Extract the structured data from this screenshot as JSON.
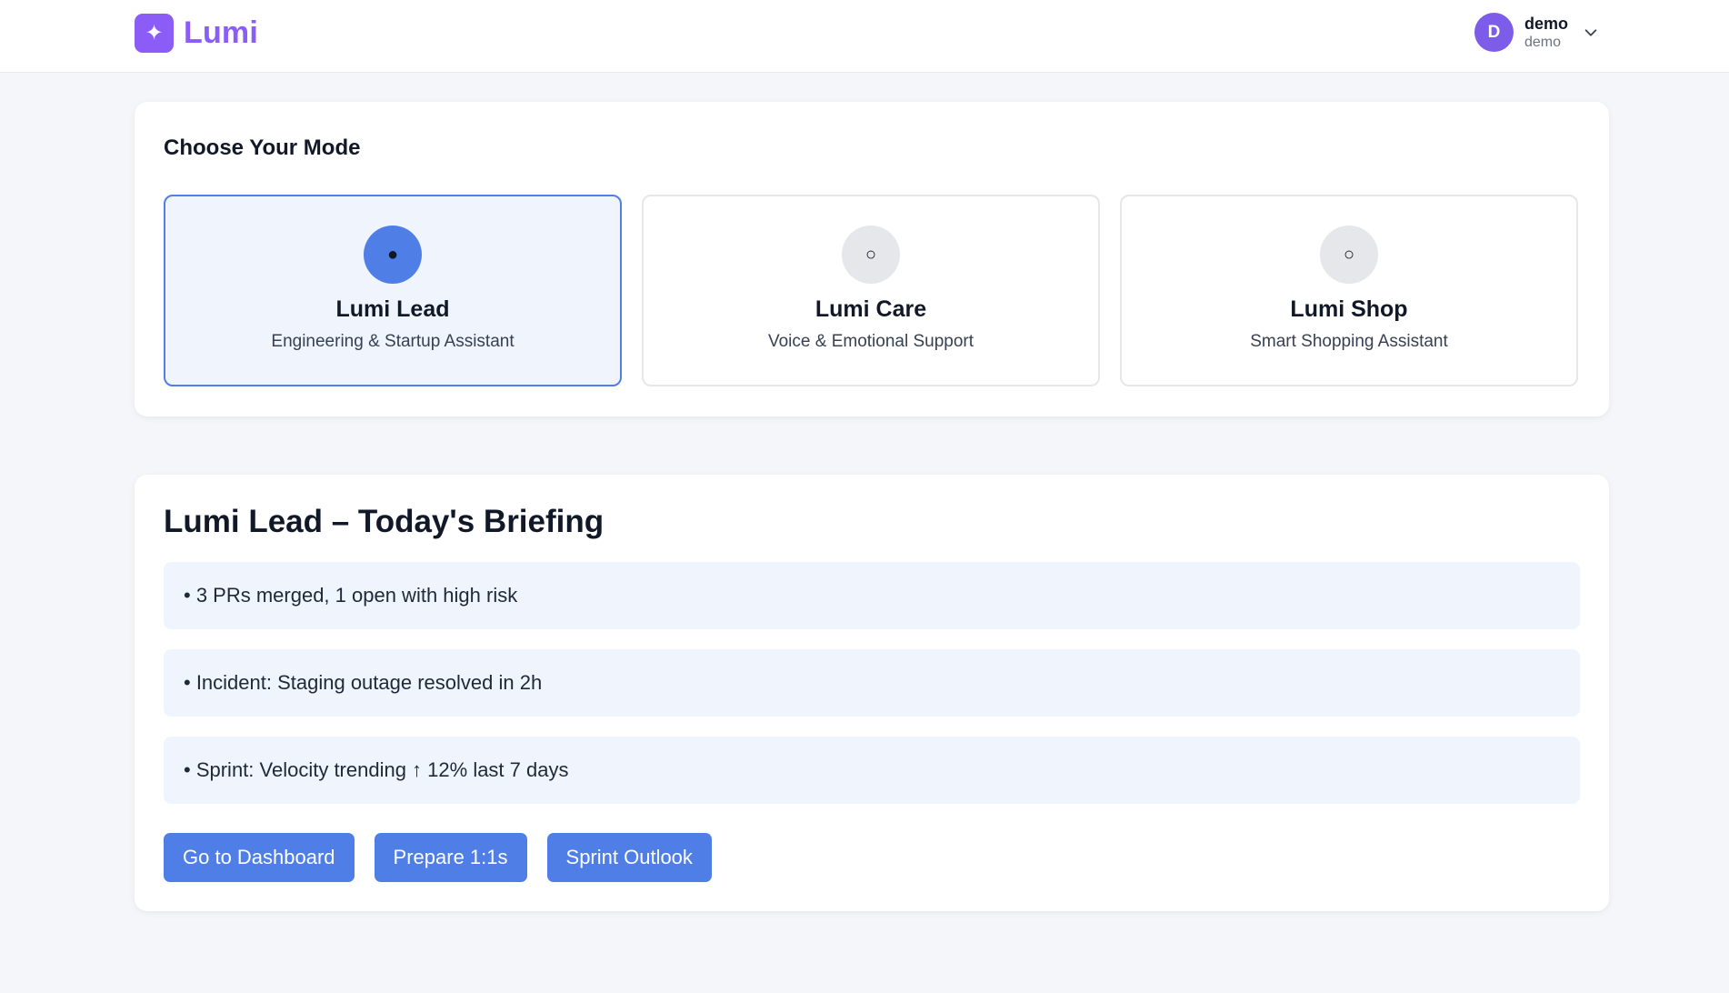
{
  "header": {
    "brand": {
      "logo_glyph": "✦",
      "name": "Lumi",
      "color": "#8b5cf6"
    },
    "user": {
      "avatar_initial": "D",
      "name": "demo",
      "subtitle": "demo",
      "avatar_color": "#7c5ce8"
    }
  },
  "mode_selector": {
    "heading": "Choose Your Mode",
    "options": [
      {
        "radio": "●",
        "title": "Lumi Lead",
        "subtitle": "Engineering & Startup Assistant",
        "selected": true
      },
      {
        "radio": "○",
        "title": "Lumi Care",
        "subtitle": "Voice & Emotional Support",
        "selected": false
      },
      {
        "radio": "○",
        "title": "Lumi Shop",
        "subtitle": "Smart Shopping Assistant",
        "selected": false
      }
    ]
  },
  "briefing": {
    "heading": "Lumi Lead – Today's Briefing",
    "items": [
      "• 3 PRs merged, 1 open with high risk",
      "• Incident: Staging outage resolved in 2h",
      "• Sprint: Velocity trending ↑ 12% last 7 days"
    ],
    "actions": [
      "Go to Dashboard",
      "Prepare 1:1s",
      "Sprint Outlook"
    ]
  },
  "colors": {
    "accent": "#4f7fe6",
    "selected_bg": "#eff4fd",
    "page_bg": "#f5f6f9"
  }
}
